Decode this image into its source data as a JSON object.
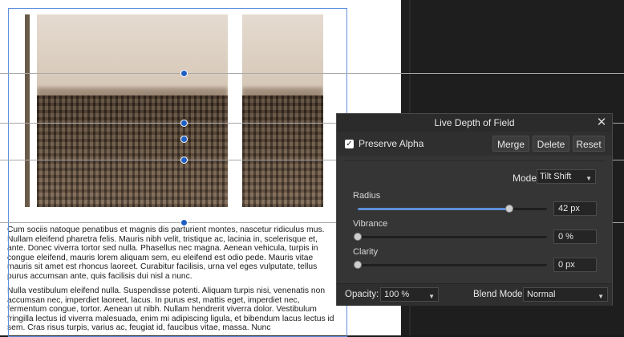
{
  "document": {
    "paragraph_1": "Cum sociis natoque penatibus et magnis dis parturient montes, nascetur ridiculus mus. Nullam eleifend pharetra felis. Mauris nibh velit, tristique ac, lacinia in, scelerisque et, ante. Donec viverra tortor sed nulla. Phasellus nec magna. Aenean vehicula, turpis in congue eleifend, mauris lorem aliquam sem, eu eleifend est odio pede. Mauris vitae mauris sit amet est rhoncus laoreet. Curabitur facilisis, urna vel eges vulputate, tellus purus accumsan ante, quis facilisis dui nisl a nunc.",
    "paragraph_2": "Nulla vestibulum eleifend nulla. Suspendisse potenti. Aliquam turpis nisi, venenatis non accumsan nec, imperdiet laoreet, lacus. In purus est, mattis eget, imperdiet nec, fermentum congue, tortor. Aenean ut nibh. Nullam hendrerit viverra dolor. Vestibulum fringilla lectus id viverra malesuada, enim mi adipiscing ligula, et bibendum lacus lectus id sem. Cras risus turpis, varius ac, feugiat id, faucibus vitae, massa. Nunc"
  },
  "panel": {
    "title": "Live Depth of Field",
    "close_glyph": "✕",
    "preserve_alpha_label": "Preserve Alpha",
    "preserve_alpha_checked": true,
    "check_glyph": "✓",
    "merge_label": "Merge",
    "delete_label": "Delete",
    "reset_label": "Reset",
    "mode_label": "Mode",
    "mode_value": "Tilt Shift",
    "caret_glyph": "▼",
    "sliders": {
      "radius": {
        "label": "Radius",
        "value": "42 px",
        "fraction": 0.8
      },
      "vibrance": {
        "label": "Vibrance",
        "value": "0 %",
        "fraction": 0.0
      },
      "clarity": {
        "label": "Clarity",
        "value": "0 px",
        "fraction": 0.0
      }
    },
    "opacity_label": "Opacity:",
    "opacity_value": "100 %",
    "blend_label": "Blend Mode:",
    "blend_value": "Normal"
  },
  "colors": {
    "accent": "#5a8fd6",
    "selection": "#1f5fc4",
    "panel_bg": "#353535"
  }
}
